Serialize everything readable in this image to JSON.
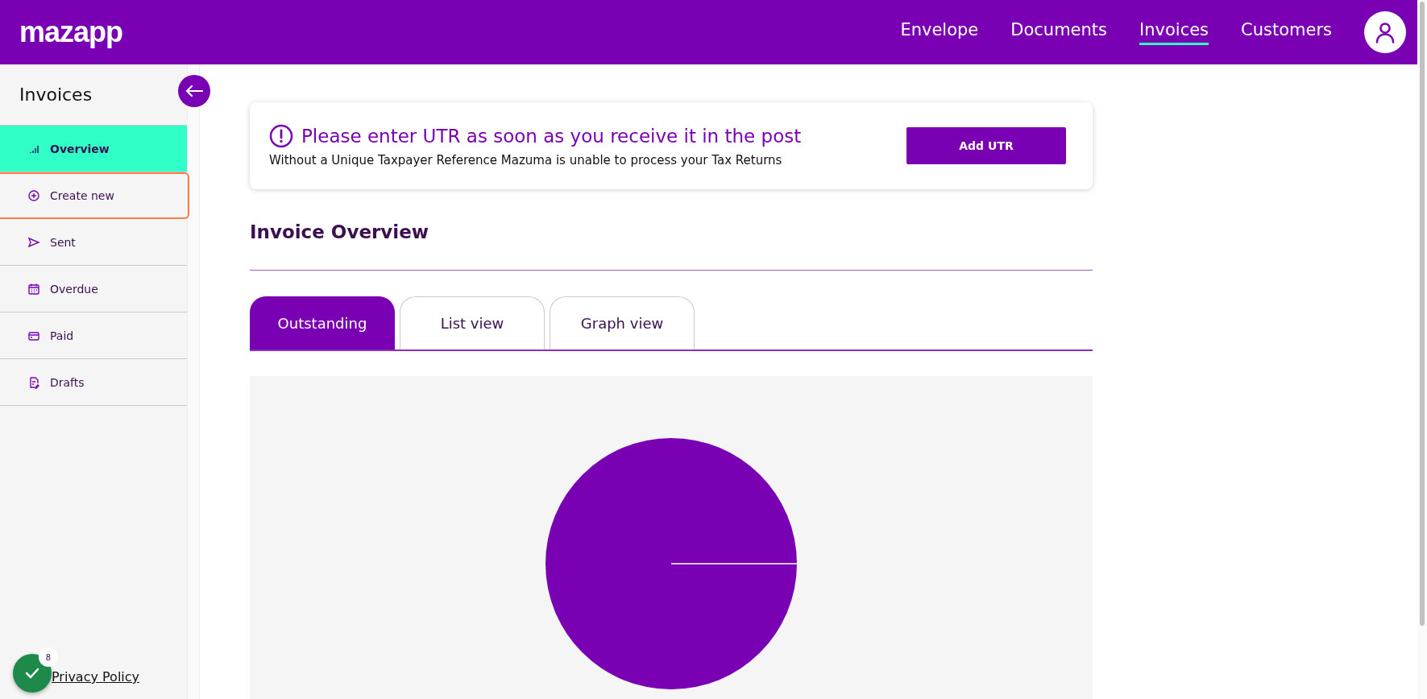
{
  "header": {
    "logo": "mazapp",
    "nav": [
      {
        "label": "Envelope",
        "selected": false
      },
      {
        "label": "Documents",
        "selected": false
      },
      {
        "label": "Invoices",
        "selected": true
      },
      {
        "label": "Customers",
        "selected": false
      }
    ]
  },
  "sidebar": {
    "title": "Invoices",
    "items": [
      {
        "label": "Overview",
        "selected": true,
        "focused": false
      },
      {
        "label": "Create new",
        "selected": false,
        "focused": true
      },
      {
        "label": "Sent",
        "selected": false,
        "focused": false
      },
      {
        "label": "Overdue",
        "selected": false,
        "focused": false
      },
      {
        "label": "Paid",
        "selected": false,
        "focused": false
      },
      {
        "label": "Drafts",
        "selected": false,
        "focused": false
      }
    ],
    "privacy_link": "Privacy Policy",
    "status_badge": "8"
  },
  "banner": {
    "title": "Please enter UTR as soon as you receive it in the post",
    "text": "Without a Unique Taxpayer Reference Mazuma is unable to process your Tax Returns",
    "button": "Add UTR"
  },
  "overview": {
    "title": "Invoice Overview",
    "tabs": [
      {
        "label": "Outstanding",
        "selected": true
      },
      {
        "label": "List view",
        "selected": false
      },
      {
        "label": "Graph view",
        "selected": false
      }
    ]
  }
}
